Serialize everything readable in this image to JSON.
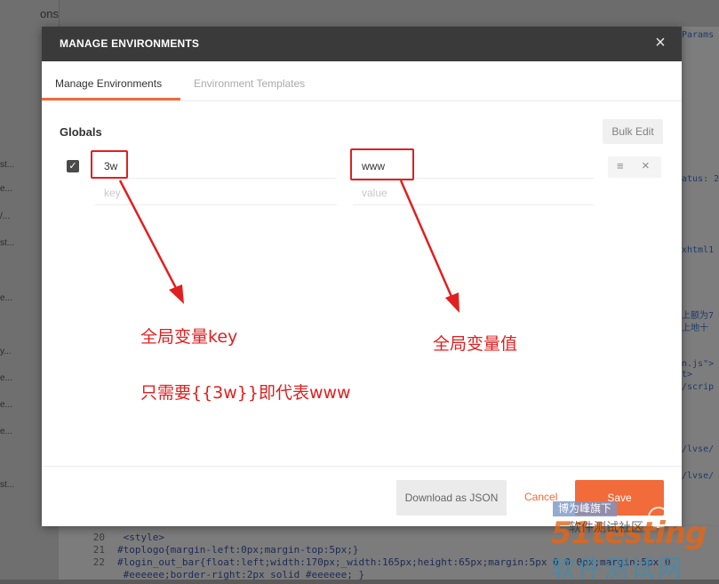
{
  "background": {
    "side_tab": "ons",
    "side_items": [
      "st...",
      "e...",
      "/...",
      "st...",
      "e...",
      "y...",
      "e...",
      "e...",
      "e...",
      "st..."
    ],
    "right_items": [
      "Params",
      "atus: 20",
      "xhtml1",
      "上额为7",
      "上地十",
      "n.js\">",
      "t>",
      "/scrip",
      "/lvse/",
      "/lvse/"
    ],
    "code_lines": [
      {
        "num": "20",
        "text": "    <style>"
      },
      {
        "num": "21",
        "text": "#toplogo{margin-left:0px;margin-top:5px;}"
      },
      {
        "num": "22",
        "text": "#login_out_bar{float:left;width:170px;_width:165px;height:65px;margin:5px 0 0 0px;margin:5px 0"
      },
      {
        "num": "",
        "text": "    #eeeeee;border-right:2px solid #eeeeee; }"
      }
    ]
  },
  "modal": {
    "title": "MANAGE ENVIRONMENTS",
    "close_icon": "×",
    "tabs": [
      {
        "label": "Manage Environments",
        "active": true
      },
      {
        "label": "Environment Templates",
        "active": false
      }
    ],
    "globals_label": "Globals",
    "bulk_edit_label": "Bulk Edit",
    "row": {
      "checked": true,
      "check_glyph": "✓",
      "key": "3w",
      "value": "www",
      "drag_glyph": "≡",
      "delete_glyph": "×"
    },
    "placeholders": {
      "key": "key",
      "value": "value"
    },
    "buttons": {
      "download": "Download as JSON",
      "cancel": "Cancel",
      "save": "Save"
    }
  },
  "annotations": {
    "key_label": "全局变量key",
    "value_label": "全局变量值",
    "note": "只需要{{3w}}即代表www",
    "color": "#e02020"
  },
  "watermark": {
    "badge": "博为峰旗下",
    "logo": "51testing",
    "sub": "软件测试社区",
    "cn": "软件测试网"
  },
  "colors": {
    "accent": "#f26b3a",
    "header": "#3a3a3a"
  }
}
